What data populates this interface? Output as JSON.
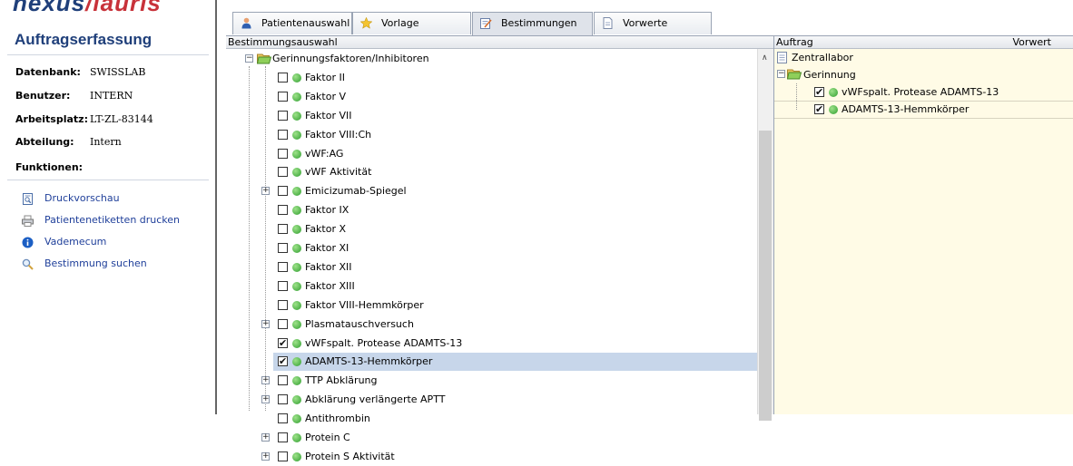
{
  "app": {
    "logo_main": "nexus",
    "logo_accent": "lauris",
    "title": "Auftragserfassung"
  },
  "info": [
    {
      "key": "Datenbank:",
      "value": "SWISSLAB"
    },
    {
      "key": "Benutzer:",
      "value": "INTERN"
    },
    {
      "key": "Arbeitsplatz:",
      "value": "LT-ZL-83144"
    },
    {
      "key": "Abteilung:",
      "value": "Intern"
    }
  ],
  "functions": {
    "heading": "Funktionen:",
    "items": [
      {
        "label": "Druckvorschau",
        "icon": "print-preview-icon"
      },
      {
        "label": "Patientenetiketten drucken",
        "icon": "printer-icon"
      },
      {
        "label": "Vademecum",
        "icon": "info-icon"
      },
      {
        "label": "Bestimmung suchen",
        "icon": "magnifier-icon"
      }
    ]
  },
  "tabs": [
    {
      "label": "Patientenauswahl",
      "icon": "person-icon",
      "active": false
    },
    {
      "label": "Vorlage",
      "icon": "star-icon",
      "active": false
    },
    {
      "label": "Bestimmungen",
      "icon": "form-edit-icon",
      "active": true
    },
    {
      "label": "Vorwerte",
      "icon": "document-icon",
      "active": false
    }
  ],
  "left_pane": {
    "header": "Bestimmungsauswahl",
    "root": "Gerinnungsfaktoren/Inhibitoren",
    "items": [
      {
        "label": "Faktor II",
        "checked": false,
        "expandable": false,
        "selected": false
      },
      {
        "label": "Faktor V",
        "checked": false,
        "expandable": false,
        "selected": false
      },
      {
        "label": "Faktor VII",
        "checked": false,
        "expandable": false,
        "selected": false
      },
      {
        "label": "Faktor VIII:Ch",
        "checked": false,
        "expandable": false,
        "selected": false
      },
      {
        "label": "vWF:AG",
        "checked": false,
        "expandable": false,
        "selected": false
      },
      {
        "label": "vWF Aktivität",
        "checked": false,
        "expandable": false,
        "selected": false
      },
      {
        "label": "Emicizumab-Spiegel",
        "checked": false,
        "expandable": true,
        "selected": false
      },
      {
        "label": "Faktor IX",
        "checked": false,
        "expandable": false,
        "selected": false
      },
      {
        "label": "Faktor X",
        "checked": false,
        "expandable": false,
        "selected": false
      },
      {
        "label": "Faktor XI",
        "checked": false,
        "expandable": false,
        "selected": false
      },
      {
        "label": "Faktor XII",
        "checked": false,
        "expandable": false,
        "selected": false
      },
      {
        "label": "Faktor XIII",
        "checked": false,
        "expandable": false,
        "selected": false
      },
      {
        "label": "Faktor VIII-Hemmkörper",
        "checked": false,
        "expandable": false,
        "selected": false
      },
      {
        "label": "Plasmatauschversuch",
        "checked": false,
        "expandable": true,
        "selected": false
      },
      {
        "label": "vWFspalt. Protease ADAMTS-13",
        "checked": true,
        "expandable": false,
        "selected": false
      },
      {
        "label": "ADAMTS-13-Hemmkörper",
        "checked": true,
        "expandable": false,
        "selected": true
      },
      {
        "label": "TTP Abklärung",
        "checked": false,
        "expandable": true,
        "selected": false
      },
      {
        "label": "Abklärung verlängerte APTT",
        "checked": false,
        "expandable": true,
        "selected": false
      },
      {
        "label": "Antithrombin",
        "checked": false,
        "expandable": false,
        "selected": false
      },
      {
        "label": "Protein C",
        "checked": false,
        "expandable": true,
        "selected": false
      },
      {
        "label": "Protein S Aktivität",
        "checked": false,
        "expandable": true,
        "selected": false
      }
    ]
  },
  "right_pane": {
    "header_left": "Auftrag",
    "header_right": "Vorwert",
    "root": "Zentrallabor",
    "group": "Gerinnung",
    "items": [
      {
        "label": "vWFspalt. Protease ADAMTS-13",
        "checked": true
      },
      {
        "label": "ADAMTS-13-Hemmkörper",
        "checked": true
      }
    ]
  }
}
